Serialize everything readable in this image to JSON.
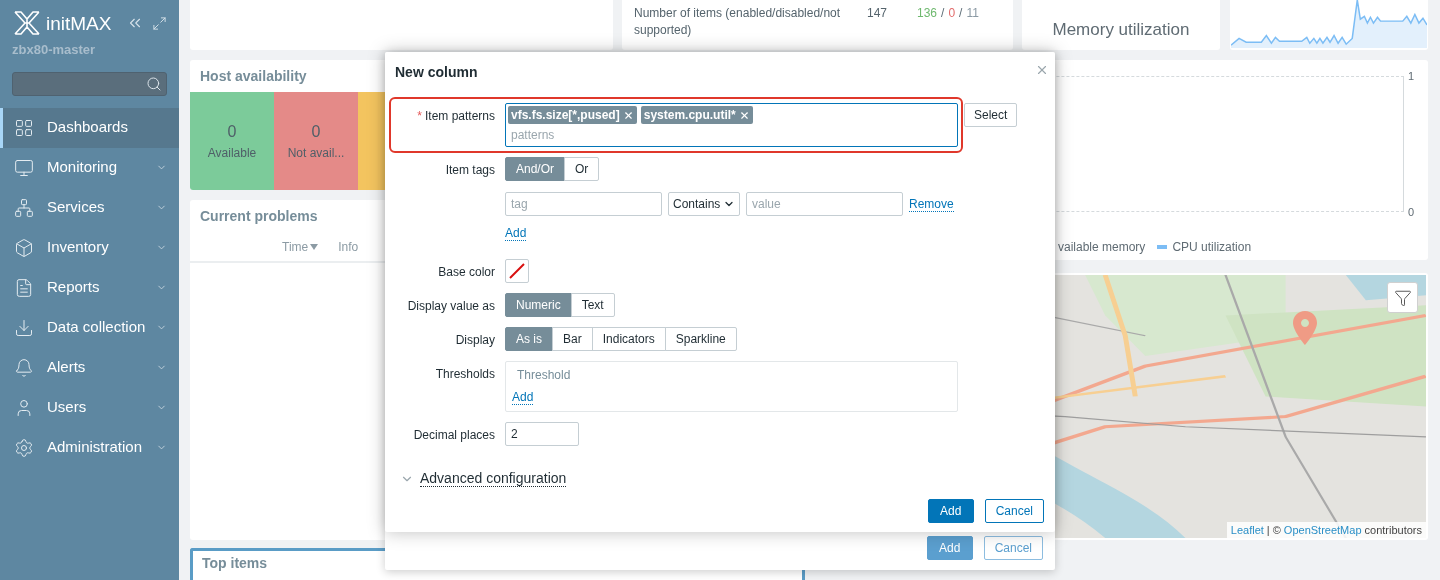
{
  "sidebar": {
    "logo": "initMAX",
    "server": "zbx80-master",
    "menu": [
      {
        "label": "Dashboards",
        "selected": true,
        "expandable": false
      },
      {
        "label": "Monitoring",
        "selected": false,
        "expandable": true
      },
      {
        "label": "Services",
        "selected": false,
        "expandable": true
      },
      {
        "label": "Inventory",
        "selected": false,
        "expandable": true
      },
      {
        "label": "Reports",
        "selected": false,
        "expandable": true
      },
      {
        "label": "Data collection",
        "selected": false,
        "expandable": true
      },
      {
        "label": "Alerts",
        "selected": false,
        "expandable": true
      },
      {
        "label": "Users",
        "selected": false,
        "expandable": true
      },
      {
        "label": "Administration",
        "selected": false,
        "expandable": true
      }
    ]
  },
  "dashboard": {
    "items_widget": {
      "label": "Number of items (enabled/disabled/not supported)",
      "total": "147",
      "parts": [
        {
          "text": "136",
          "kind": "enabled"
        },
        {
          "text": "/",
          "kind": "separator"
        },
        {
          "text": "0",
          "kind": "disabled"
        },
        {
          "text": "/",
          "kind": "separator"
        },
        {
          "text": "11",
          "kind": "unsupported"
        }
      ]
    },
    "memory_widget": {
      "title": "Memory utilization"
    },
    "host_availability": {
      "title": "Host availability",
      "tiles": [
        {
          "count": "0",
          "label": "Available",
          "color": "#7ccb9a"
        },
        {
          "count": "0",
          "label": "Not avail...",
          "color": "#e48a88"
        },
        {
          "color": "#f3c45f"
        }
      ]
    },
    "current_problems": {
      "title": "Current problems",
      "columns": [
        {
          "label": "Time",
          "sorted": true
        },
        {
          "label": "Info",
          "sorted": false
        }
      ]
    },
    "graph": {
      "y_max": "1",
      "y_min": "0",
      "legend": [
        {
          "label": "vailable memory"
        },
        {
          "label": "CPU utilization",
          "color": "#7cbdf5"
        }
      ]
    },
    "map": {
      "attribution_link_1": "Leaflet",
      "attribution_separator": "| ©",
      "attribution_link_2": "OpenStreetMap",
      "attribution_suffix": "contributors"
    },
    "top_items": {
      "title": "Top items",
      "editing": true
    }
  },
  "parent_dialog": {
    "buttons": [
      {
        "label": "Add",
        "kind": "primary"
      },
      {
        "label": "Cancel",
        "kind": "secondary"
      }
    ]
  },
  "dialog": {
    "title": "New column",
    "item_patterns": {
      "label": "Item patterns",
      "required_mark": "*",
      "highlight": true,
      "chips": [
        "vfs.fs.size[*,pused]",
        "system.cpu.util*"
      ],
      "placeholder": "patterns",
      "select_button": "Select"
    },
    "item_tags": {
      "label": "Item tags",
      "options": [
        {
          "label": "And/Or",
          "selected": true
        },
        {
          "label": "Or",
          "selected": false
        }
      ],
      "tag_placeholder": "tag",
      "operator": "Contains",
      "value_placeholder": "value",
      "remove": "Remove",
      "add": "Add"
    },
    "base_color": {
      "label": "Base color"
    },
    "display_value_as": {
      "label": "Display value as",
      "options": [
        {
          "label": "Numeric",
          "selected": true
        },
        {
          "label": "Text",
          "selected": false
        }
      ]
    },
    "display": {
      "label": "Display",
      "options": [
        {
          "label": "As is",
          "selected": true
        },
        {
          "label": "Bar",
          "selected": false
        },
        {
          "label": "Indicators",
          "selected": false
        },
        {
          "label": "Sparkline",
          "selected": false
        }
      ]
    },
    "thresholds": {
      "label": "Thresholds",
      "header": "Threshold",
      "add": "Add"
    },
    "decimal_places": {
      "label": "Decimal places",
      "value": "2"
    },
    "advanced": {
      "label": "Advanced configuration",
      "expanded": false
    },
    "buttons": [
      {
        "label": "Add",
        "kind": "primary"
      },
      {
        "label": "Cancel",
        "kind": "secondary"
      }
    ]
  }
}
